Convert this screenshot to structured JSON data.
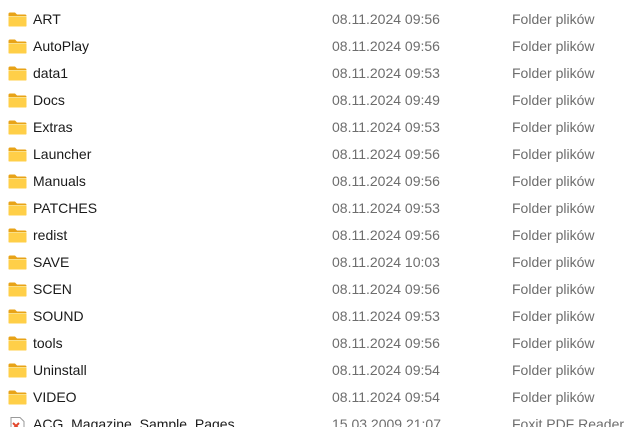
{
  "files": [
    {
      "name": "ART",
      "date": "08.11.2024 09:56",
      "type": "Folder plików",
      "icon": "folder-icon"
    },
    {
      "name": "AutoPlay",
      "date": "08.11.2024 09:56",
      "type": "Folder plików",
      "icon": "folder-icon"
    },
    {
      "name": "data1",
      "date": "08.11.2024 09:53",
      "type": "Folder plików",
      "icon": "folder-icon"
    },
    {
      "name": "Docs",
      "date": "08.11.2024 09:49",
      "type": "Folder plików",
      "icon": "folder-icon"
    },
    {
      "name": "Extras",
      "date": "08.11.2024 09:53",
      "type": "Folder plików",
      "icon": "folder-icon"
    },
    {
      "name": "Launcher",
      "date": "08.11.2024 09:56",
      "type": "Folder plików",
      "icon": "folder-icon"
    },
    {
      "name": "Manuals",
      "date": "08.11.2024 09:56",
      "type": "Folder plików",
      "icon": "folder-icon"
    },
    {
      "name": "PATCHES",
      "date": "08.11.2024 09:53",
      "type": "Folder plików",
      "icon": "folder-icon"
    },
    {
      "name": "redist",
      "date": "08.11.2024 09:56",
      "type": "Folder plików",
      "icon": "folder-icon"
    },
    {
      "name": "SAVE",
      "date": "08.11.2024 10:03",
      "type": "Folder plików",
      "icon": "folder-icon"
    },
    {
      "name": "SCEN",
      "date": "08.11.2024 09:56",
      "type": "Folder plików",
      "icon": "folder-icon"
    },
    {
      "name": "SOUND",
      "date": "08.11.2024 09:53",
      "type": "Folder plików",
      "icon": "folder-icon"
    },
    {
      "name": "tools",
      "date": "08.11.2024 09:56",
      "type": "Folder plików",
      "icon": "folder-icon"
    },
    {
      "name": "Uninstall",
      "date": "08.11.2024 09:54",
      "type": "Folder plików",
      "icon": "folder-icon"
    },
    {
      "name": "VIDEO",
      "date": "08.11.2024 09:54",
      "type": "Folder plików",
      "icon": "folder-icon"
    },
    {
      "name": "ACG_Magazine_Sample_Pages",
      "date": "15.03.2009 21:07",
      "type": "Foxit PDF Reader ...",
      "icon": "pdf-file-icon"
    }
  ]
}
